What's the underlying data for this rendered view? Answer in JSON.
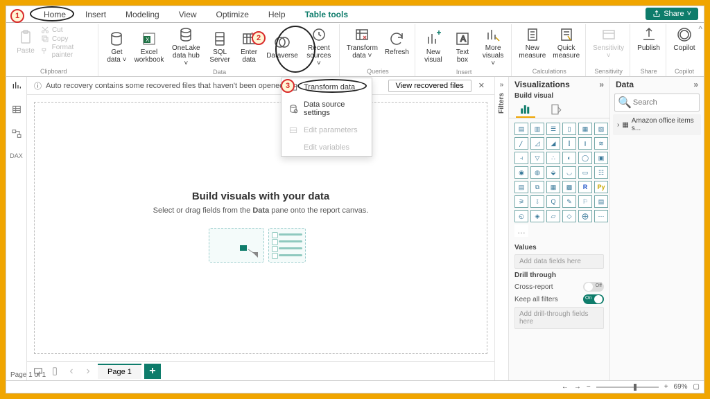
{
  "tabs": {
    "home": "Home",
    "insert": "Insert",
    "modeling": "Modeling",
    "view": "View",
    "optimize": "Optimize",
    "help": "Help",
    "tabletools": "Table tools"
  },
  "share_label": "Share",
  "ribbon": {
    "paste": "Paste",
    "cut": "Cut",
    "copy": "Copy",
    "format_painter": "Format painter",
    "get_data": "Get\ndata ˅",
    "excel": "Excel\nworkbook",
    "onelake": "OneLake\ndata hub ˅",
    "sql": "SQL\nServer",
    "enter": "Enter\ndata",
    "dataverse": "Dataverse",
    "recent": "Recent\nsources ˅",
    "transform": "Transform\ndata ˅",
    "refresh": "Refresh",
    "new_visual": "New\nvisual",
    "text_box": "Text\nbox",
    "more_visuals": "More\nvisuals ˅",
    "new_measure": "New\nmeasure",
    "quick_measure": "Quick\nmeasure",
    "sensitivity": "Sensitivity\n˅",
    "publish": "Publish",
    "copilot": "Copilot",
    "groups": {
      "clipboard": "Clipboard",
      "data": "Data",
      "queries": "Queries",
      "insert": "Insert",
      "calculations": "Calculations",
      "sensitivity": "Sensitivity",
      "share": "Share",
      "copilot": "Copilot"
    }
  },
  "dropdown": {
    "transform_data": "Transform data",
    "data_source": "Data source settings",
    "edit_params": "Edit parameters",
    "edit_vars": "Edit variables"
  },
  "recovery": {
    "msg": "Auto recovery contains some recovered files that haven't been opened.",
    "btn": "View recovered files"
  },
  "canvas": {
    "title": "Build visuals with your data",
    "sub_a": "Select or drag fields from the ",
    "sub_b": "Data",
    "sub_c": " pane onto the report canvas."
  },
  "filters_label": "Filters",
  "viz": {
    "title": "Visualizations",
    "subtitle": "Build visual",
    "values": "Values",
    "values_ph": "Add data fields here",
    "drill": "Drill through",
    "cross": "Cross-report",
    "cross_state": "Off",
    "keep": "Keep all filters",
    "keep_state": "On",
    "drill_ph": "Add drill-through fields here"
  },
  "data_pane": {
    "title": "Data",
    "search_ph": "Search",
    "table": "Amazon office items s..."
  },
  "pages": {
    "page1": "Page 1",
    "info": "Page 1 of 1"
  },
  "status": {
    "zoom": "69%",
    "plus": "+",
    "left_arrow": "←",
    "right_arrow": "→"
  },
  "callouts": {
    "c1": "1",
    "c2": "2",
    "c3": "3"
  }
}
